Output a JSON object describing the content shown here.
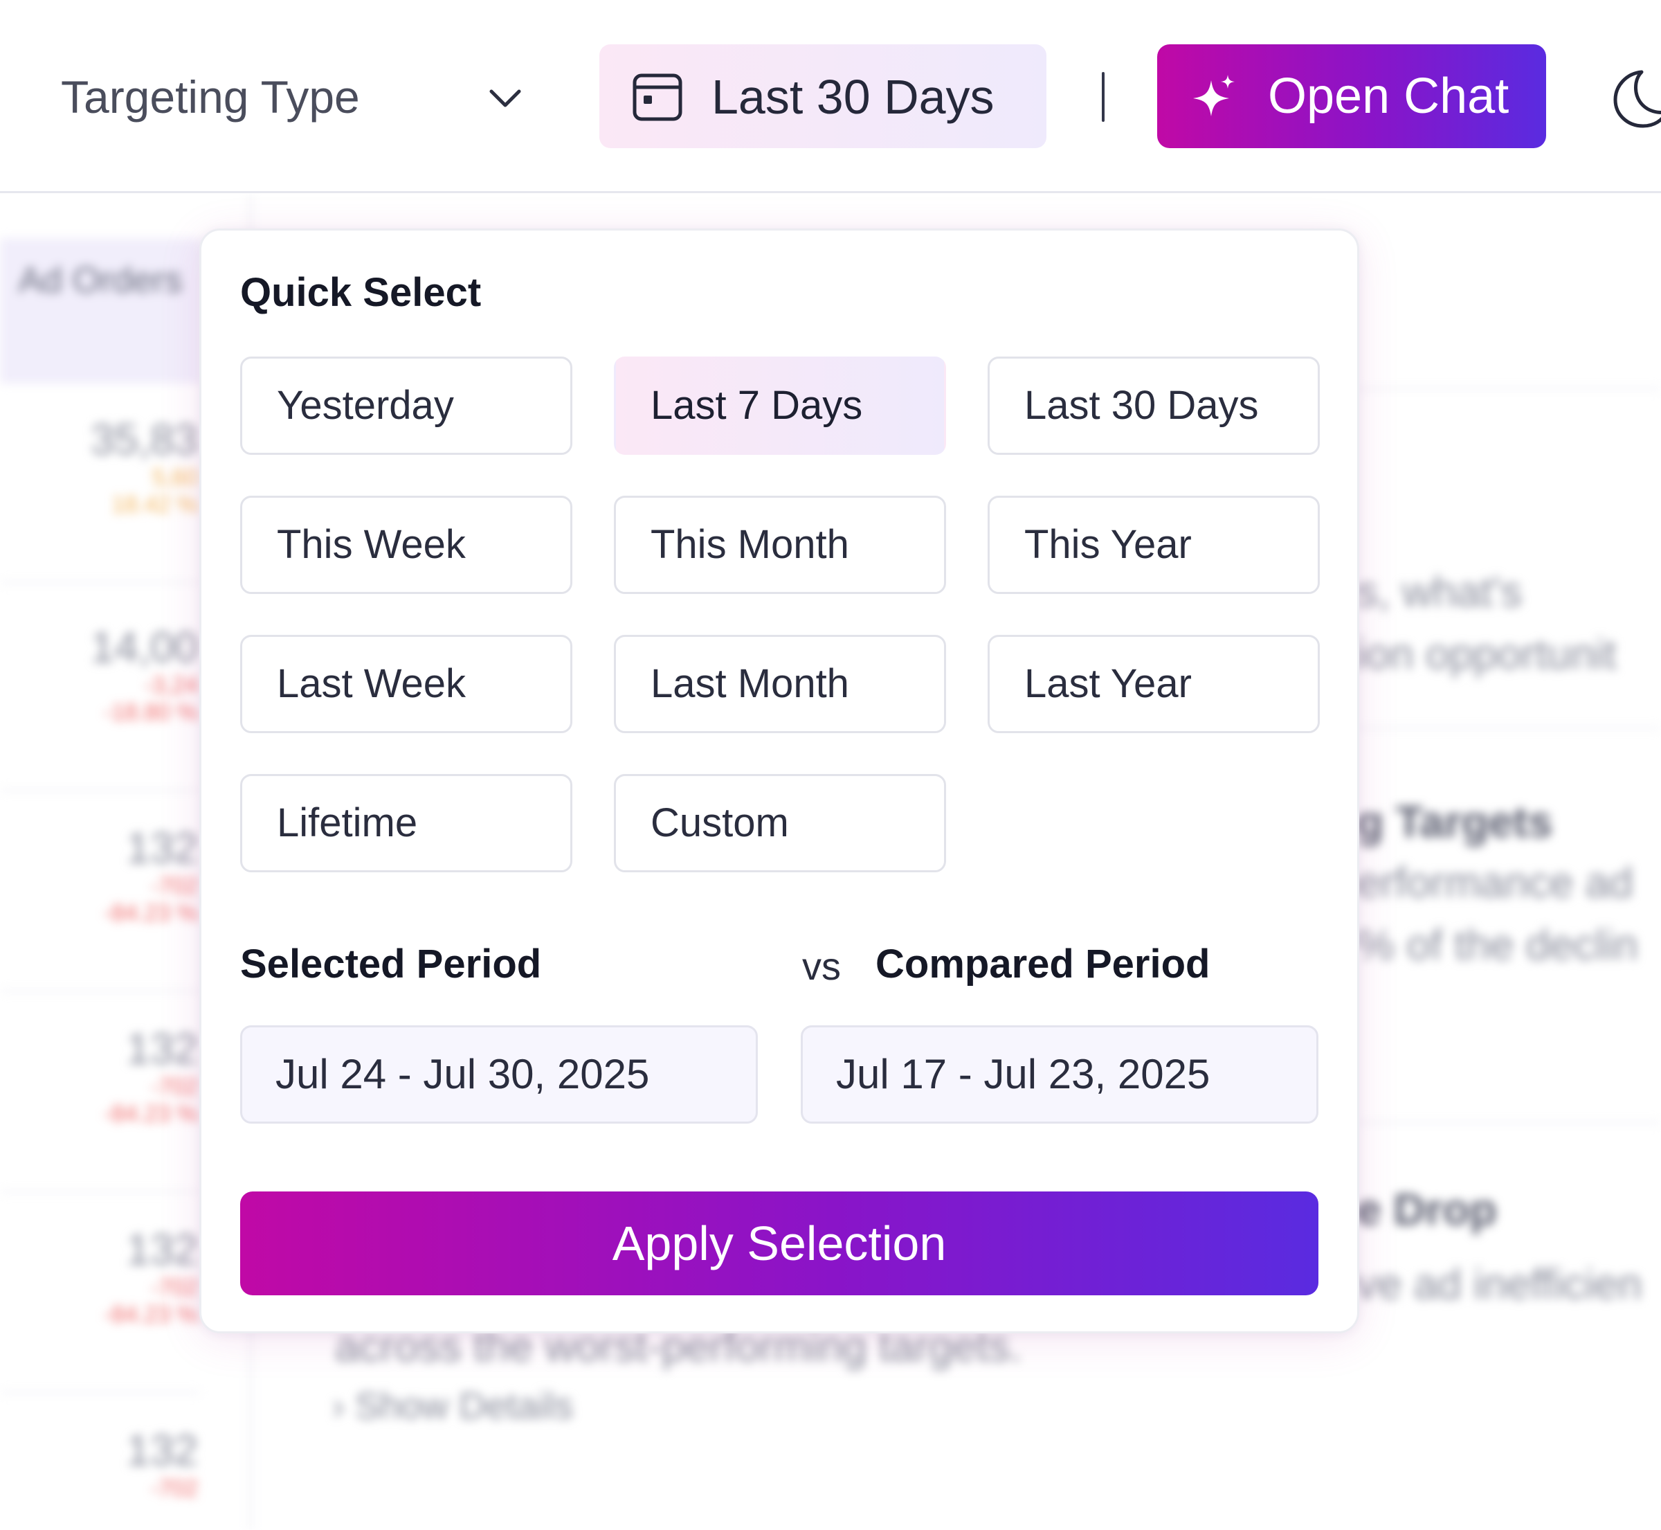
{
  "header": {
    "targeting_label": "Targeting Type",
    "date_range_label": "Last 30 Days",
    "chat_label": "Open Chat",
    "icons": {
      "targeting": "chevron-down-icon",
      "date": "calendar-icon",
      "chat": "sparkle-icon",
      "theme": "moon-icon"
    }
  },
  "date_picker": {
    "title": "Quick Select",
    "options": [
      {
        "label": "Yesterday",
        "active": false
      },
      {
        "label": "Last 7 Days",
        "active": true
      },
      {
        "label": "Last 30 Days",
        "active": false
      },
      {
        "label": "This Week",
        "active": false
      },
      {
        "label": "This Month",
        "active": false
      },
      {
        "label": "This Year",
        "active": false
      },
      {
        "label": "Last Week",
        "active": false
      },
      {
        "label": "Last Month",
        "active": false
      },
      {
        "label": "Last Year",
        "active": false
      },
      {
        "label": "Lifetime",
        "active": false
      },
      {
        "label": "Custom",
        "active": false
      }
    ],
    "selected_period_label": "Selected Period",
    "vs_label": "vs",
    "compared_period_label": "Compared Period",
    "selected_period_value": "Jul 24 - Jul 30, 2025",
    "compared_period_value": "Jul 17 - Jul 23, 2025",
    "apply_label": "Apply Selection"
  },
  "background": {
    "column_header": "Ad Orders",
    "rows": [
      {
        "value": "35,83",
        "delta1": "5,60",
        "delta2": "18.42 %",
        "color": "#f3b45a"
      },
      {
        "value": "14,00",
        "delta1": "-3,24",
        "delta2": "-18.80 %",
        "color": "#f06a6a"
      },
      {
        "value": "132",
        "delta1": "-702",
        "delta2": "-84.23 %",
        "color": "#f06a6a"
      },
      {
        "value": "132",
        "delta1": "-702",
        "delta2": "-84.23 %",
        "color": "#f06a6a"
      },
      {
        "value": "132",
        "delta1": "-702",
        "delta2": "-84.23 %",
        "color": "#f06a6a"
      },
      {
        "value": "132",
        "delta1": "-702",
        "delta2": "",
        "color": "#f06a6a"
      }
    ],
    "snippets": {
      "s1": "s, what's",
      "s2": "ion opportunit",
      "h1": "g Targets",
      "s3": "erformance ad",
      "s4": "% of the declin",
      "h2": "e Drop",
      "s5": "ve ad inefficien",
      "s6": "across the worst-performing targets.",
      "s7": "Show Details"
    }
  },
  "colors": {
    "accent_start": "#c009a6",
    "accent_end": "#5a2be0",
    "active_bg_start": "#fbe8f6",
    "active_bg_end": "#efeafc"
  }
}
